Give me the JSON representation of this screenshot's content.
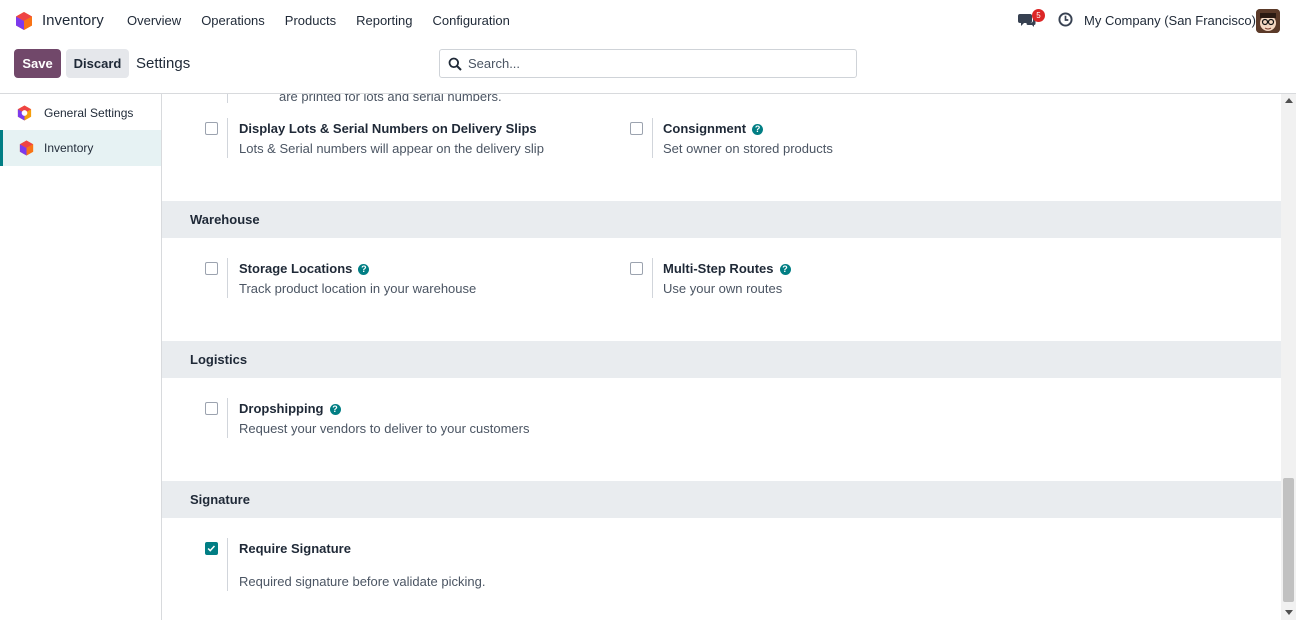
{
  "navbar": {
    "app_name": "Inventory",
    "menu": [
      "Overview",
      "Operations",
      "Products",
      "Reporting",
      "Configuration"
    ],
    "chat_count": "5",
    "company": "My Company (San Francisco)"
  },
  "control": {
    "save_label": "Save",
    "discard_label": "Discard",
    "breadcrumb": "Settings",
    "search_placeholder": "Search..."
  },
  "sidebar": {
    "items": [
      {
        "label": "General Settings",
        "active": false
      },
      {
        "label": "Inventory",
        "active": true
      }
    ]
  },
  "main": {
    "partial_text": "are printed for lots and serial numbers.",
    "top_settings": [
      {
        "title": "Display Lots & Serial Numbers on Delivery Slips",
        "desc": "Lots & Serial numbers will appear on the delivery slip",
        "checked": false,
        "help": false
      },
      {
        "title": "Consignment",
        "desc": "Set owner on stored products",
        "checked": false,
        "help": true
      }
    ],
    "sections": [
      {
        "title": "Warehouse",
        "settings": [
          {
            "title": "Storage Locations",
            "desc": "Track product location in your warehouse",
            "checked": false,
            "help": true
          },
          {
            "title": "Multi-Step Routes",
            "desc": "Use your own routes",
            "checked": false,
            "help": true
          }
        ]
      },
      {
        "title": "Logistics",
        "settings": [
          {
            "title": "Dropshipping",
            "desc": "Request your vendors to deliver to your customers",
            "checked": false,
            "help": true
          }
        ]
      },
      {
        "title": "Signature",
        "settings": [
          {
            "title": "Require Signature",
            "desc": "Required signature before validate picking.",
            "checked": true,
            "help": false
          }
        ]
      }
    ]
  },
  "colors": {
    "brand": "#71486a",
    "accent": "#017e84",
    "section_bg": "#e9ecef",
    "badge": "#dc2626"
  }
}
